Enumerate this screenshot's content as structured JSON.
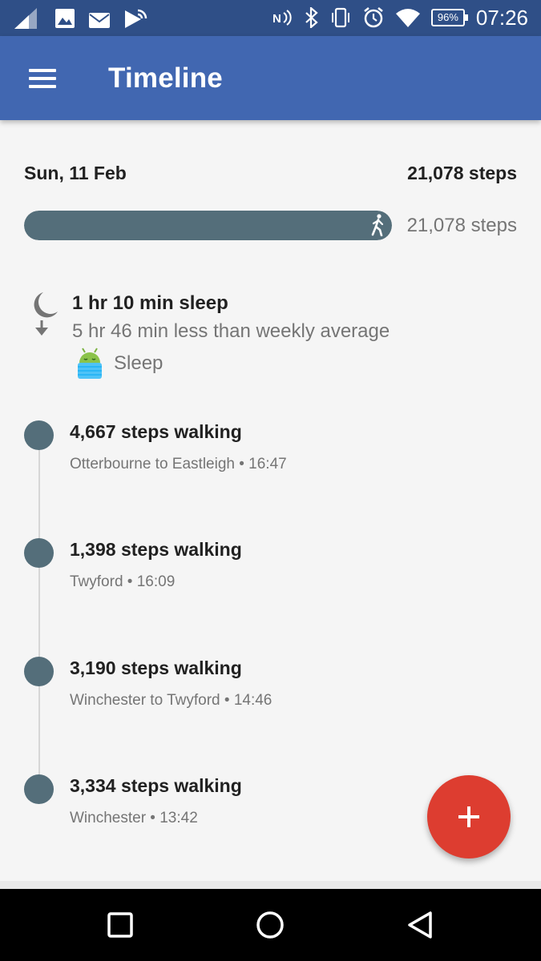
{
  "status_bar": {
    "battery": "96%",
    "time": "07:26",
    "left_icons": [
      "signal-icon",
      "image-icon",
      "mail-icon",
      "cast-icon"
    ],
    "right_icons": [
      "nfc-icon",
      "bluetooth-icon",
      "vibrate-icon",
      "alarm-icon",
      "wifi-icon",
      "battery-icon"
    ]
  },
  "app_bar": {
    "title": "Timeline",
    "menu_icon": "hamburger-menu-icon"
  },
  "summary": {
    "date": "Sun, 11 Feb",
    "total_steps": "21,078 steps",
    "bar_label": "21,078 steps",
    "progress_fraction": 1.0,
    "bar_icon": "walker-icon"
  },
  "sleep": {
    "title": "1 hr 10 min sleep",
    "subtitle": "5 hr 46 min less than weekly average",
    "source_label": "Sleep",
    "icon": "moon-icon"
  },
  "timeline": [
    {
      "title": "4,667 steps walking",
      "subtitle": "Otterbourne to Eastleigh • 16:47"
    },
    {
      "title": "1,398 steps walking",
      "subtitle": "Twyford • 16:09"
    },
    {
      "title": "3,190 steps walking",
      "subtitle": "Winchester to Twyford • 14:46"
    },
    {
      "title": "3,334 steps walking",
      "subtitle": "Winchester • 13:42"
    }
  ],
  "fab": {
    "icon": "plus-icon"
  },
  "nav_bar": {
    "icons": [
      "recents-icon",
      "home-icon",
      "back-icon"
    ]
  },
  "colors": {
    "status_bar": "#2f4f87",
    "app_bar": "#4167b1",
    "progress": "#546e7a",
    "fab": "#dd3d30"
  }
}
